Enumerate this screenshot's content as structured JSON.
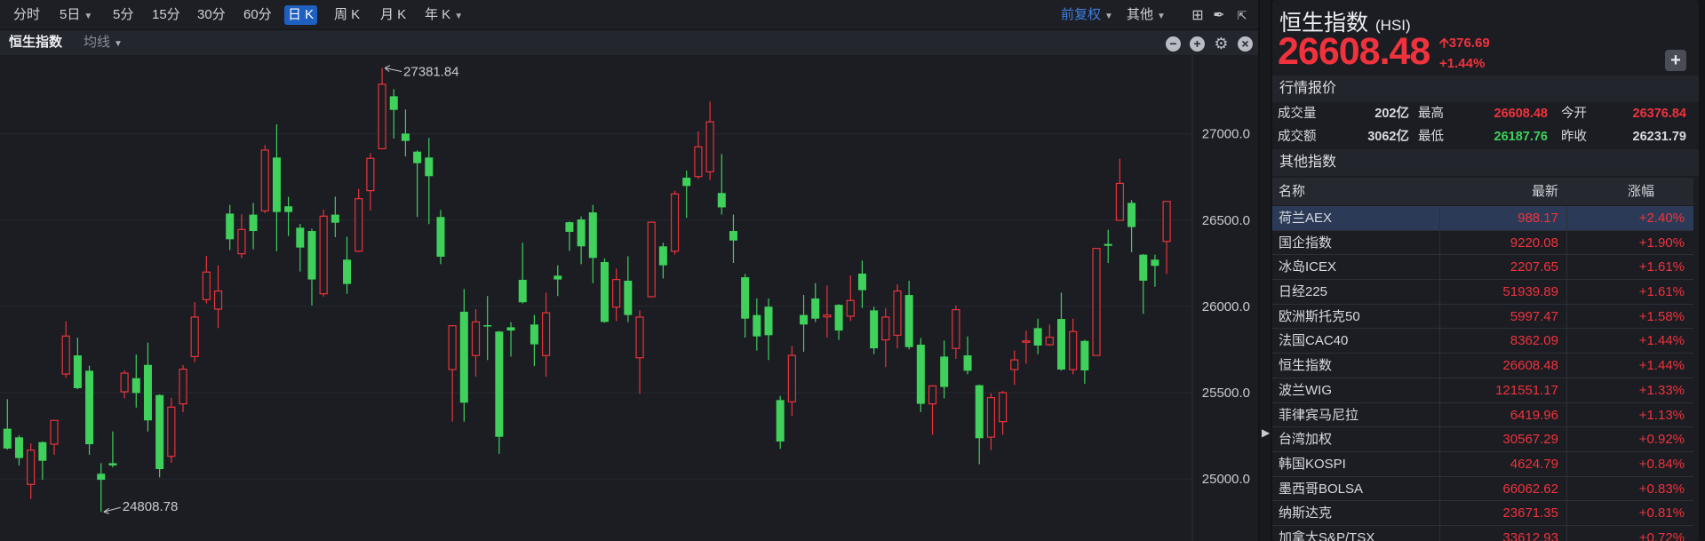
{
  "toolbar": {
    "periods": [
      "分时",
      "5日",
      "5分",
      "15分",
      "30分",
      "60分",
      "日 K",
      "周 K",
      "月 K",
      "年 K"
    ],
    "active": "日 K",
    "adjust": "前复权",
    "other": "其他"
  },
  "chart_header": {
    "title": "恒生指数",
    "ma": "均线"
  },
  "quote": {
    "name": "恒生指数",
    "code": "(HSI)",
    "price": "26608.48",
    "change": "376.69",
    "change_pct": "+1.44%",
    "section": "行情报价",
    "rows": [
      {
        "l1": "成交量",
        "v1": "202亿",
        "l2": "最高",
        "v2": "26608.48",
        "l3": "今开",
        "v3": "26376.84"
      },
      {
        "l1": "成交额",
        "v1": "3062亿",
        "l2": "最低",
        "v2": "26187.76",
        "l3": "昨收",
        "v3": "26231.79"
      }
    ]
  },
  "others": {
    "section": "其他指数",
    "headers": [
      "名称",
      "最新",
      "涨幅"
    ],
    "rows": [
      [
        "荷兰AEX",
        "988.17",
        "+2.40%"
      ],
      [
        "国企指数",
        "9220.08",
        "+1.90%"
      ],
      [
        "冰岛ICEX",
        "2207.65",
        "+1.61%"
      ],
      [
        "日经225",
        "51939.89",
        "+1.61%"
      ],
      [
        "欧洲斯托克50",
        "5997.47",
        "+1.58%"
      ],
      [
        "法国CAC40",
        "8362.09",
        "+1.44%"
      ],
      [
        "恒生指数",
        "26608.48",
        "+1.44%"
      ],
      [
        "波兰WIG",
        "121551.17",
        "+1.33%"
      ],
      [
        "菲律宾马尼拉",
        "6419.96",
        "+1.13%"
      ],
      [
        "台湾加权",
        "30567.29",
        "+0.92%"
      ],
      [
        "韩国KOSPI",
        "4624.79",
        "+0.84%"
      ],
      [
        "墨西哥BOLSA",
        "66062.62",
        "+0.83%"
      ],
      [
        "纳斯达克",
        "23671.35",
        "+0.81%"
      ],
      [
        "加拿大S&P/TSX",
        "33612.93",
        "+0.72%"
      ]
    ]
  },
  "colors": {
    "up": "#e8343a",
    "down": "#3fd15b",
    "accent": "#1f5fbf"
  },
  "chart_data": {
    "type": "candlestick",
    "ylim": [
      24700,
      27550
    ],
    "yticks": [
      "27000.0",
      "26500.0",
      "25500.0",
      "26000.0",
      "25000.0"
    ],
    "ytick_values": [
      27000,
      26500,
      25500,
      26000,
      25000
    ],
    "annotations": {
      "high": "27381.84",
      "low": "24808.78",
      "high_index": 32,
      "low_index": 8
    },
    "ohlc": [
      [
        25291,
        25462,
        25170,
        25176
      ],
      [
        25241,
        25253,
        25078,
        25121
      ],
      [
        24968,
        25205,
        24884,
        25167
      ],
      [
        25213,
        25218,
        24995,
        25105
      ],
      [
        25201,
        25342,
        25140,
        25339
      ],
      [
        25608,
        25914,
        25586,
        25828
      ],
      [
        25716,
        25819,
        25520,
        25526
      ],
      [
        25627,
        25656,
        25140,
        25201
      ],
      [
        25030,
        25091,
        24808.78,
        24995
      ],
      [
        25091,
        25275,
        25067,
        25078
      ],
      [
        25505,
        25630,
        25467,
        25613
      ],
      [
        25584,
        25721,
        25414,
        25498
      ],
      [
        25661,
        25790,
        25275,
        25339
      ],
      [
        25486,
        25490,
        25009,
        25057
      ],
      [
        25131,
        25469,
        25093,
        25416
      ],
      [
        25435,
        25660,
        25387,
        25636
      ],
      [
        25709,
        26025,
        25677,
        25938
      ],
      [
        26039,
        26293,
        26017,
        26199
      ],
      [
        25984,
        26238,
        25874,
        26089
      ],
      [
        26538,
        26588,
        26326,
        26389
      ],
      [
        26305,
        26533,
        26279,
        26446
      ],
      [
        26532,
        26600,
        26331,
        26437
      ],
      [
        26554,
        26935,
        26540,
        26906
      ],
      [
        26863,
        27055,
        26320,
        26547
      ],
      [
        26580,
        26635,
        26408,
        26547
      ],
      [
        26456,
        26478,
        26202,
        26341
      ],
      [
        26437,
        26451,
        26005,
        26156
      ],
      [
        26073,
        26561,
        26056,
        26523
      ],
      [
        26532,
        26636,
        26401,
        26485
      ],
      [
        26271,
        26403,
        26073,
        26130
      ],
      [
        26320,
        26681,
        26315,
        26624
      ],
      [
        26671,
        26889,
        26556,
        26858
      ],
      [
        26914,
        27381.84,
        26910,
        27288
      ],
      [
        27218,
        27259,
        26973,
        27139
      ],
      [
        27002,
        27141,
        26870,
        26959
      ],
      [
        26897,
        26904,
        26518,
        26830
      ],
      [
        26863,
        26976,
        26477,
        26755
      ],
      [
        26518,
        26559,
        26245,
        26288
      ],
      [
        25634,
        25891,
        25332,
        25888
      ],
      [
        25969,
        26101,
        25332,
        25442
      ],
      [
        25715,
        25984,
        25593,
        25910
      ],
      [
        25891,
        26060,
        25689,
        25886
      ],
      [
        25854,
        25857,
        25146,
        25244
      ],
      [
        25879,
        25909,
        25709,
        25860
      ],
      [
        26154,
        26369,
        26017,
        26024
      ],
      [
        25895,
        25950,
        25654,
        25780
      ],
      [
        25715,
        26080,
        25593,
        25963
      ],
      [
        26178,
        26238,
        26060,
        26156
      ],
      [
        26488,
        26492,
        26322,
        26432
      ],
      [
        26504,
        26521,
        26245,
        26348
      ],
      [
        26545,
        26588,
        26135,
        26281
      ],
      [
        26257,
        26278,
        25905,
        25910
      ],
      [
        25996,
        26219,
        25915,
        26156
      ],
      [
        26149,
        26291,
        25909,
        25950
      ],
      [
        25702,
        25977,
        25493,
        25938
      ],
      [
        26056,
        26492,
        26052,
        26488
      ],
      [
        26348,
        26369,
        26162,
        26238
      ],
      [
        26320,
        26671,
        26300,
        26652
      ],
      [
        26746,
        26787,
        26513,
        26698
      ],
      [
        26753,
        27014,
        26739,
        26925
      ],
      [
        26780,
        27187,
        26732,
        27070
      ],
      [
        26657,
        26883,
        26532,
        26574
      ],
      [
        26437,
        26532,
        26252,
        26382
      ],
      [
        26169,
        26188,
        25819,
        25929
      ],
      [
        25950,
        26046,
        25744,
        25826
      ],
      [
        25998,
        26046,
        25689,
        25833
      ],
      [
        25457,
        25481,
        25174,
        25217
      ],
      [
        25447,
        25771,
        25366,
        25716
      ],
      [
        25950,
        26066,
        25737,
        25895
      ],
      [
        26046,
        26135,
        25909,
        25929
      ],
      [
        25939,
        26121,
        25819,
        25950
      ],
      [
        26009,
        26013,
        25806,
        25860
      ],
      [
        25943,
        26180,
        25915,
        26034
      ],
      [
        26190,
        26266,
        25991,
        26094
      ],
      [
        25977,
        25998,
        25723,
        25757
      ],
      [
        25806,
        25991,
        25648,
        25938
      ],
      [
        25833,
        26128,
        25757,
        26089
      ],
      [
        26066,
        26149,
        25751,
        25764
      ],
      [
        25778,
        25816,
        25387,
        25435
      ],
      [
        25435,
        25543,
        25256,
        25539
      ],
      [
        25709,
        25802,
        25467,
        25533
      ],
      [
        25756,
        26005,
        25696,
        25981
      ],
      [
        25716,
        25826,
        25606,
        25627
      ],
      [
        25543,
        25547,
        25085,
        25236
      ],
      [
        25242,
        25497,
        25167,
        25471
      ],
      [
        25332,
        25510,
        25256,
        25500
      ],
      [
        25634,
        25744,
        25545,
        25690
      ],
      [
        25792,
        25860,
        25668,
        25800
      ],
      [
        25874,
        25929,
        25723,
        25773
      ],
      [
        25778,
        25895,
        25771,
        25821
      ],
      [
        25927,
        26080,
        25627,
        25634
      ],
      [
        25634,
        25929,
        25606,
        25854
      ],
      [
        25800,
        25806,
        25551,
        25629
      ],
      [
        25716,
        26338,
        25714,
        26336
      ],
      [
        26362,
        26444,
        26252,
        26351
      ],
      [
        26499,
        26856,
        26497,
        26713
      ],
      [
        26600,
        26616,
        26314,
        26460
      ],
      [
        26300,
        26303,
        25957,
        26149
      ],
      [
        26271,
        26300,
        26114,
        26235
      ],
      [
        26376.84,
        26608.48,
        26187.76,
        26608.48
      ]
    ]
  }
}
